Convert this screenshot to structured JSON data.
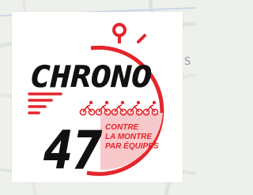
{
  "edge_text": "S",
  "logo": {
    "word": "CHRONO",
    "number": "47",
    "tagline": [
      "CONTRE",
      "LA MONTRE",
      "PAR ÉQUIPES"
    ],
    "colors": {
      "red": "#e5252c",
      "pink": "#f7c9cb",
      "black": "#111111"
    },
    "cyclist_icon_count": 5
  }
}
